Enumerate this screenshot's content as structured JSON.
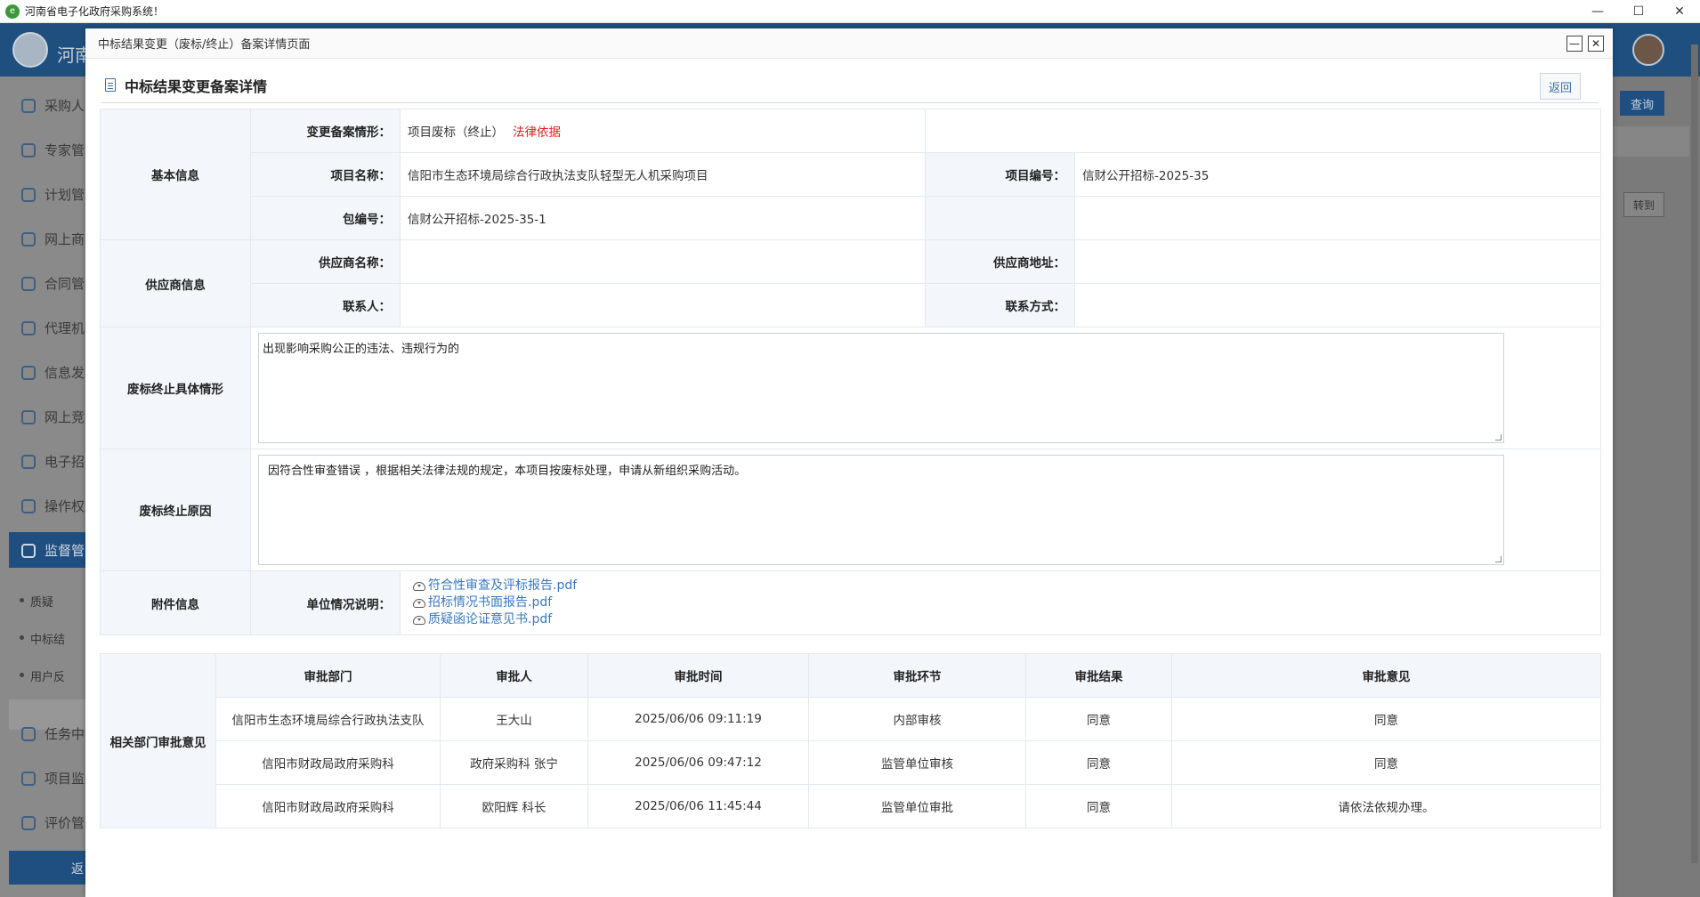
{
  "os": {
    "window_title": "河南省电子化政府采购系统！",
    "minimize": "—",
    "maximize": "☐",
    "close": "✕"
  },
  "background": {
    "brand": "河南",
    "sidebar": [
      "采购人",
      "专家管",
      "计划管",
      "网上商",
      "合同管",
      "代理机",
      "信息发",
      "网上竞",
      "电子招",
      "操作权",
      "监督管",
      "任务中",
      "项目监",
      "评价管"
    ],
    "sub_items": [
      "质疑",
      "中标结",
      "用户反"
    ],
    "back_label": "返",
    "query_label": "查询",
    "goto_label": "转到"
  },
  "modal": {
    "title": "中标结果变更（废标/终止）备案详情页面",
    "section_title": "中标结果变更备案详情",
    "back_button": "返回"
  },
  "detail": {
    "basic_info_label": "基本信息",
    "change_type_label": "变更备案情形：",
    "change_type_value": "项目废标（终止）",
    "legal_basis_link": "法律依据",
    "project_name_label": "项目名称：",
    "project_name_value": "信阳市生态环境局综合行政执法支队轻型无人机采购项目",
    "project_no_label": "项目编号：",
    "project_no_value": "信财公开招标-2025-35",
    "package_no_label": "包编号：",
    "package_no_value": "信财公开招标-2025-35-1",
    "supplier_info_label": "供应商信息",
    "supplier_name_label": "供应商名称：",
    "supplier_name_value": "",
    "supplier_address_label": "供应商地址：",
    "supplier_address_value": "",
    "contact_label": "联系人：",
    "contact_value": "",
    "contact_method_label": "联系方式：",
    "contact_method_value": "",
    "situation_label": "废标终止具体情形",
    "situation_text": "出现影响采购公正的违法、违规行为的",
    "reason_label": "废标终止原因",
    "reason_text": "因符合性审查错误 ，根据相关法律法规的规定，本项目按废标处理，申请从新组织采购活动。",
    "attachment_label": "附件信息",
    "unit_desc_label": "单位情况说明：",
    "files": [
      "符合性审查及评标报告.pdf",
      "招标情况书面报告.pdf",
      "质疑函论证意见书.pdf"
    ]
  },
  "approval": {
    "group_label": "相关部门审批意见",
    "headers": [
      "审批部门",
      "审批人",
      "审批时间",
      "审批环节",
      "审批结果",
      "审批意见"
    ],
    "rows": [
      [
        "信阳市生态环境局综合行政执法支队",
        "王大山",
        "2025/06/06 09:11:19",
        "内部审核",
        "同意",
        "同意"
      ],
      [
        "信阳市财政局政府采购科",
        "政府采购科 张宁",
        "2025/06/06 09:47:12",
        "监管单位审核",
        "同意",
        "同意"
      ],
      [
        "信阳市财政局政府采购科",
        "欧阳辉 科长",
        "2025/06/06 11:45:44",
        "监管单位审批",
        "同意",
        "请依法依规办理。"
      ]
    ]
  }
}
